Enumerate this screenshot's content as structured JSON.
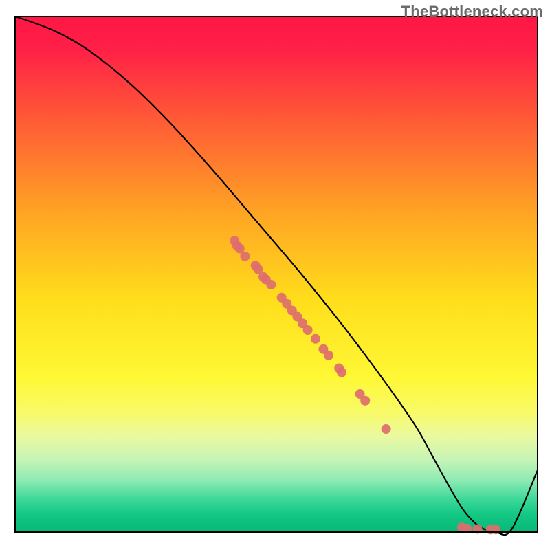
{
  "watermark": "TheBottleneck.com",
  "chart_data": {
    "type": "line",
    "title": "",
    "xlabel": "",
    "ylabel": "",
    "xlim": [
      0,
      100
    ],
    "ylim": [
      0,
      100
    ],
    "grid": false,
    "legend": false,
    "background": {
      "type": "vertical-gradient",
      "stops": [
        {
          "pos": 0.0,
          "color": "#ff1744"
        },
        {
          "pos": 0.06,
          "color": "#ff1f47"
        },
        {
          "pos": 0.2,
          "color": "#ff5a36"
        },
        {
          "pos": 0.38,
          "color": "#ffa424"
        },
        {
          "pos": 0.55,
          "color": "#ffde1b"
        },
        {
          "pos": 0.7,
          "color": "#fff835"
        },
        {
          "pos": 0.77,
          "color": "#f8fa6a"
        },
        {
          "pos": 0.815,
          "color": "#e9f9a0"
        },
        {
          "pos": 0.86,
          "color": "#c6f4b6"
        },
        {
          "pos": 0.9,
          "color": "#8ceab3"
        },
        {
          "pos": 0.935,
          "color": "#3fd99a"
        },
        {
          "pos": 0.965,
          "color": "#14c884"
        },
        {
          "pos": 1.0,
          "color": "#07b877"
        }
      ]
    },
    "series": [
      {
        "name": "bottleneck-curve",
        "color": "#000000",
        "x": [
          0,
          3,
          8,
          14,
          22,
          30,
          38,
          46,
          54,
          62,
          68,
          73,
          77,
          80,
          83,
          86,
          89,
          92,
          95,
          100
        ],
        "y": [
          100,
          99,
          97,
          93.5,
          87,
          79,
          70,
          60.5,
          51,
          41,
          33,
          26,
          20,
          14.5,
          9,
          4,
          1,
          0,
          0.5,
          12
        ]
      }
    ],
    "points": {
      "name": "data-points",
      "color": "#dd6e6e",
      "radius": 7,
      "coords": [
        {
          "x": 42.0,
          "y": 56.5
        },
        {
          "x": 42.5,
          "y": 55.5
        },
        {
          "x": 43.0,
          "y": 55.0
        },
        {
          "x": 44.0,
          "y": 53.5
        },
        {
          "x": 46.0,
          "y": 51.7
        },
        {
          "x": 46.5,
          "y": 51.0
        },
        {
          "x": 47.5,
          "y": 49.5
        },
        {
          "x": 48.0,
          "y": 49.0
        },
        {
          "x": 49.0,
          "y": 48.0
        },
        {
          "x": 51.0,
          "y": 45.5
        },
        {
          "x": 52.0,
          "y": 44.3
        },
        {
          "x": 53.0,
          "y": 43.0
        },
        {
          "x": 54.0,
          "y": 41.8
        },
        {
          "x": 55.0,
          "y": 40.5
        },
        {
          "x": 56.0,
          "y": 39.2
        },
        {
          "x": 57.5,
          "y": 37.5
        },
        {
          "x": 59.0,
          "y": 35.5
        },
        {
          "x": 60.0,
          "y": 34.3
        },
        {
          "x": 62.0,
          "y": 31.8
        },
        {
          "x": 62.5,
          "y": 31.0
        },
        {
          "x": 66.0,
          "y": 26.8
        },
        {
          "x": 67.0,
          "y": 25.5
        },
        {
          "x": 71.0,
          "y": 20.0
        },
        {
          "x": 85.5,
          "y": 0.9
        },
        {
          "x": 86.5,
          "y": 0.7
        },
        {
          "x": 88.5,
          "y": 0.6
        },
        {
          "x": 91.0,
          "y": 0.5
        },
        {
          "x": 92.0,
          "y": 0.5
        }
      ]
    }
  }
}
